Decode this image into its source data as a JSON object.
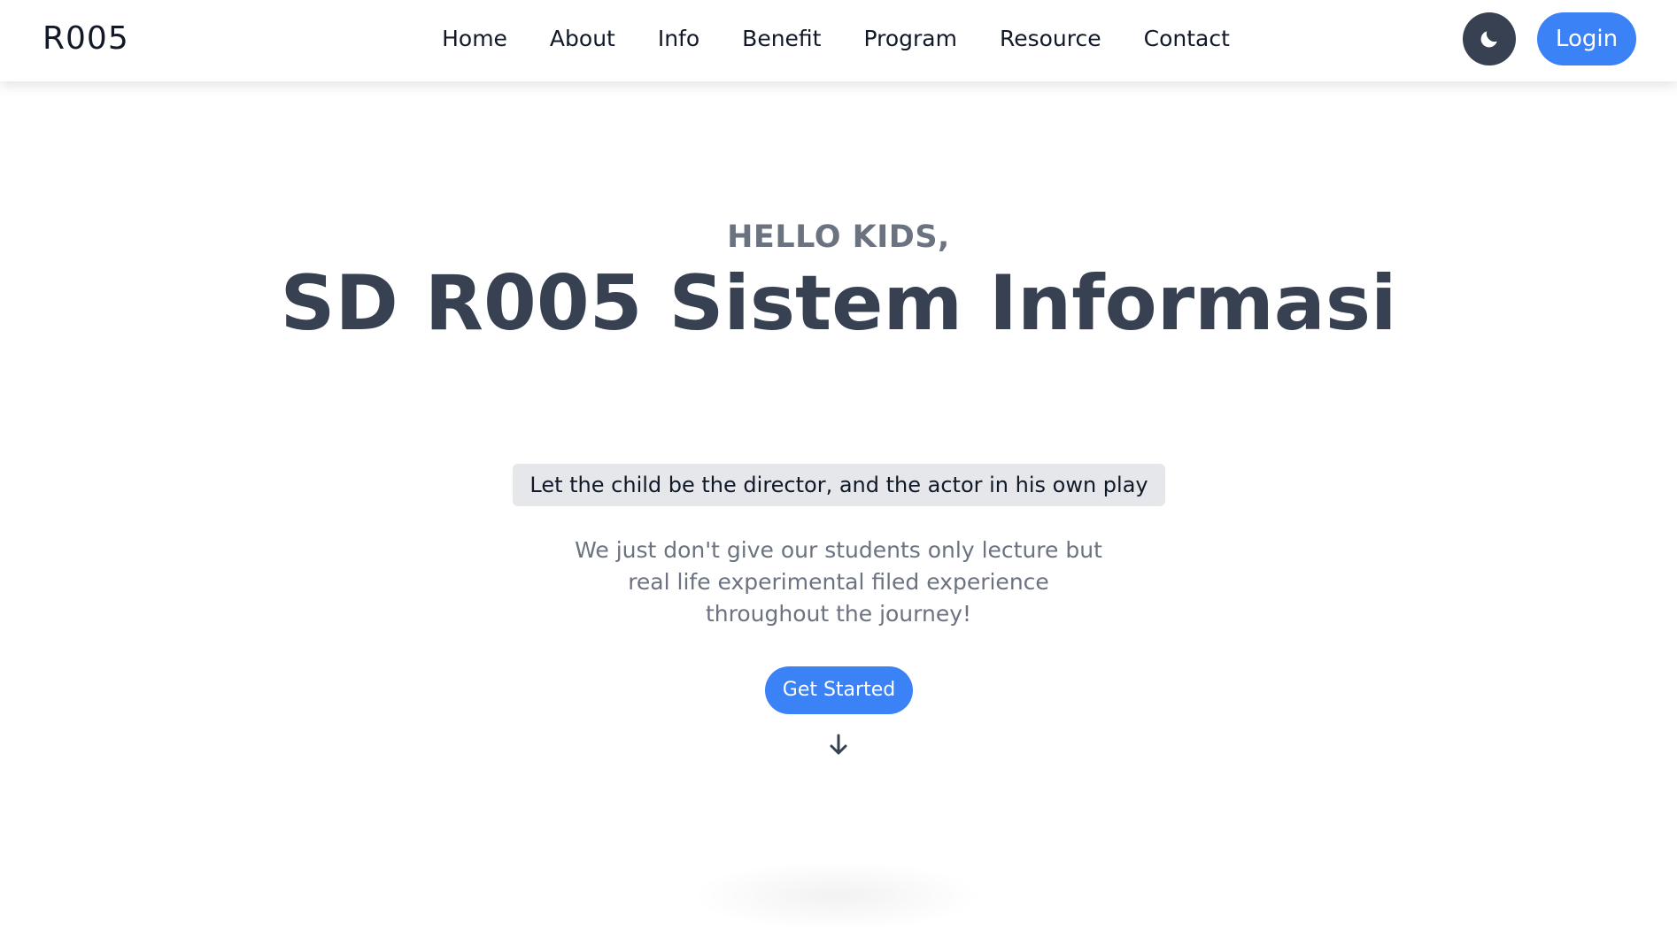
{
  "navbar": {
    "brand": "R005",
    "links": [
      {
        "label": "Home"
      },
      {
        "label": "About"
      },
      {
        "label": "Info"
      },
      {
        "label": "Benefit"
      },
      {
        "label": "Program"
      },
      {
        "label": "Resource"
      },
      {
        "label": "Contact"
      }
    ],
    "theme_toggle_icon": "moon-icon",
    "login_label": "Login"
  },
  "hero": {
    "eyebrow": "HELLO KIDS,",
    "title": "SD R005 Sistem Informasi",
    "quote": "Let the child be the director, and the actor in his own play",
    "description": "We just don't give our students only lecture but real life experimental filed experience throughout the journey!",
    "cta_label": "Get Started",
    "scroll_icon": "arrow-down-icon"
  },
  "colors": {
    "accent": "#3b82f6",
    "dark": "#374151",
    "muted": "#6b7280",
    "quote_bg": "#e5e7eb"
  }
}
